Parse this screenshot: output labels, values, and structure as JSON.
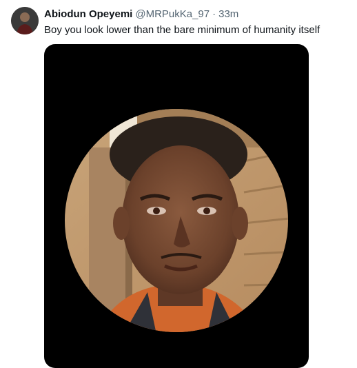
{
  "tweet": {
    "author": {
      "display_name": "Abiodun Opeyemi",
      "handle": "@MRPukKa_97"
    },
    "separator": "·",
    "timestamp": "33m",
    "text": "Boy you look lower than the bare minimum of humanity itself"
  },
  "media": {
    "type": "image",
    "description_icon": "circular-selfie-photo"
  },
  "colors": {
    "text_primary": "#0f1419",
    "text_secondary": "#536471",
    "media_background": "#000000"
  }
}
